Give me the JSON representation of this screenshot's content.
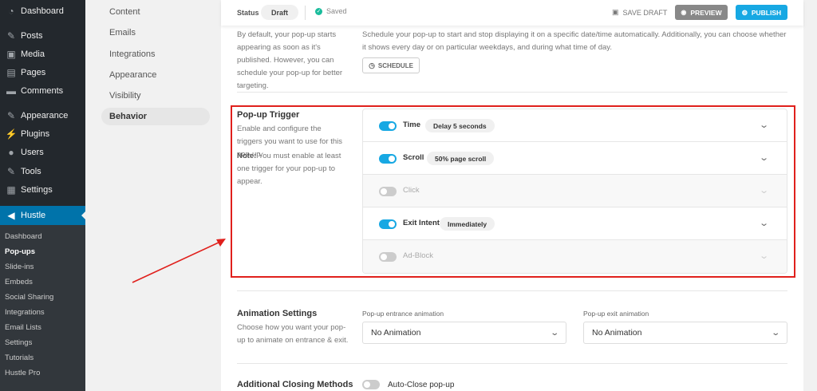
{
  "wp_menu": {
    "items": [
      {
        "label": "Dashboard",
        "icon": "dashboard-icon",
        "glyph": "◔"
      },
      {
        "label": "Posts",
        "icon": "pin-icon",
        "glyph": "✎"
      },
      {
        "label": "Media",
        "icon": "media-icon",
        "glyph": "▣"
      },
      {
        "label": "Pages",
        "icon": "pages-icon",
        "glyph": "▤"
      },
      {
        "label": "Comments",
        "icon": "comments-icon",
        "glyph": "▬"
      },
      {
        "label": "Appearance",
        "icon": "brush-icon",
        "glyph": "✎"
      },
      {
        "label": "Plugins",
        "icon": "plugin-icon",
        "glyph": "⚡"
      },
      {
        "label": "Users",
        "icon": "users-icon",
        "glyph": "●"
      },
      {
        "label": "Tools",
        "icon": "wrench-icon",
        "glyph": "✎"
      },
      {
        "label": "Settings",
        "icon": "settings-icon",
        "glyph": "▦"
      }
    ],
    "hustle_label": "Hustle",
    "submenu": [
      "Dashboard",
      "Pop-ups",
      "Slide-ins",
      "Embeds",
      "Social Sharing",
      "Integrations",
      "Email Lists",
      "Settings",
      "Tutorials",
      "Hustle Pro"
    ],
    "current_submenu": "Pop-ups"
  },
  "hustle_nav": {
    "items": [
      "Content",
      "Emails",
      "Integrations",
      "Appearance",
      "Visibility",
      "Behavior"
    ],
    "active": "Behavior"
  },
  "status_bar": {
    "status_label": "Status",
    "status_value": "Draft",
    "saved_label": "Saved",
    "save_draft_label": "SAVE DRAFT",
    "preview_label": "PREVIEW",
    "publish_label": "PUBLISH"
  },
  "schedule": {
    "left_desc": "By default, your pop-up starts appearing as soon as it's published. However, you can schedule your pop-up for better targeting.",
    "right_desc": "Schedule your pop-up to start and stop displaying it on a specific date/time automatically. Additionally, you can choose whether it shows every day or on particular weekdays, and during what time of day.",
    "button_label": "SCHEDULE"
  },
  "popup_trigger": {
    "title": "Pop-up Trigger",
    "desc": "Enable and configure the triggers you want to use for this pop-up.",
    "note_label": "Note:",
    "note_text": "You must enable at least one trigger for your pop-up to appear.",
    "triggers": [
      {
        "name": "Time",
        "enabled": true,
        "value": "Delay 5 seconds"
      },
      {
        "name": "Scroll",
        "enabled": true,
        "value": "50% page scroll"
      },
      {
        "name": "Click",
        "enabled": false,
        "value": ""
      },
      {
        "name": "Exit Intent",
        "enabled": true,
        "value": "Immediately"
      },
      {
        "name": "Ad-Block",
        "enabled": false,
        "value": ""
      }
    ]
  },
  "animation": {
    "title": "Animation Settings",
    "desc": "Choose how you want your pop-up to animate on entrance & exit.",
    "entrance_label": "Pop-up entrance animation",
    "entrance_value": "No Animation",
    "exit_label": "Pop-up exit animation",
    "exit_value": "No Animation"
  },
  "closing": {
    "title": "Additional Closing Methods",
    "autoclose_label": "Auto-Close pop-up",
    "autoclose_enabled": false
  },
  "annotation": {
    "highlight_color": "#e0201c"
  }
}
